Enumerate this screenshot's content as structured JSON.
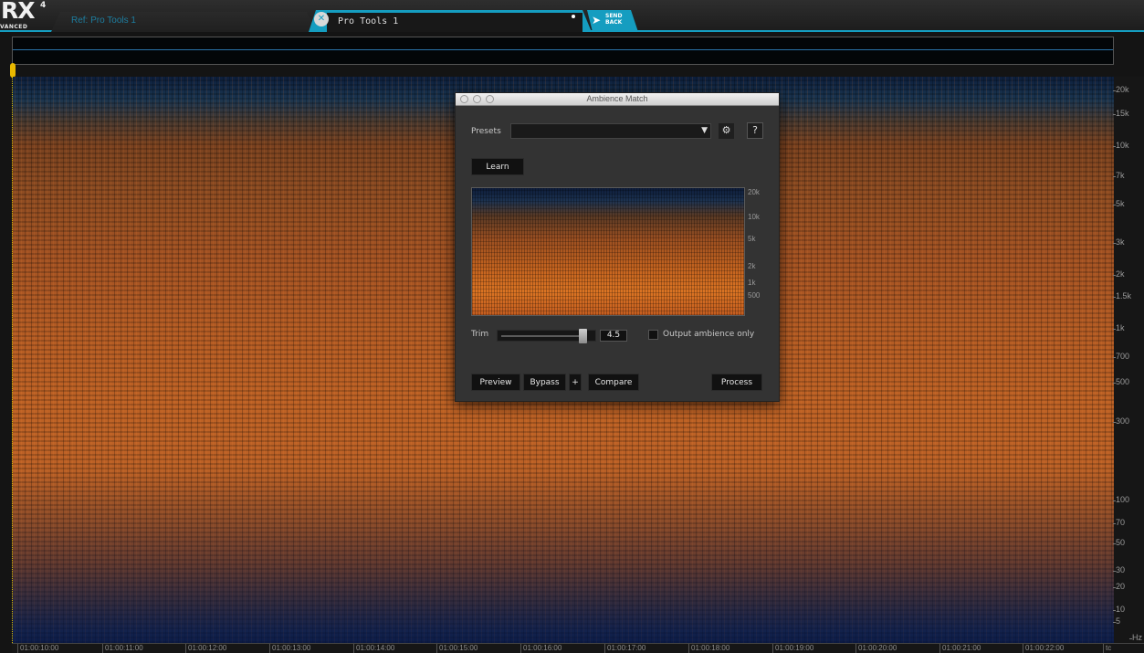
{
  "app": {
    "logo": "RX",
    "logo_version": "4",
    "logo_subtitle": "VANCED"
  },
  "tabs": {
    "ref_tab": "Ref: Pro Tools 1",
    "active_tab": "Pro Tools 1",
    "send_back_label": "SEND BACK"
  },
  "frequency_axis": {
    "labels": [
      "20k",
      "15k",
      "10k",
      "7k",
      "5k",
      "3k",
      "2k",
      "1.5k",
      "1k",
      "700",
      "500",
      "300",
      "100",
      "70",
      "50",
      "30",
      "20",
      "10",
      "5"
    ],
    "unit": "Hz"
  },
  "time_axis": {
    "labels": [
      "01:00:10:00",
      "01:00:11:00",
      "01:00:12:00",
      "01:00:13:00",
      "01:00:14:00",
      "01:00:15:00",
      "01:00:16:00",
      "01:00:17:00",
      "01:00:18:00",
      "01:00:19:00",
      "01:00:20:00",
      "01:00:21:00",
      "01:00:22:00"
    ],
    "unit": "tc"
  },
  "dialog": {
    "title": "Ambience Match",
    "presets_label": "Presets",
    "presets_value": "",
    "presets_arrow": "▼",
    "gear_icon": "⚙",
    "help_label": "?",
    "learn_label": "Learn",
    "mini_spectrum_labels": [
      "20k",
      "10k",
      "5k",
      "2k",
      "1k",
      "500"
    ],
    "trim_label": "Trim",
    "trim_value": "4.5",
    "trim_level": 0.91,
    "output_ambience_label": "Output ambience only",
    "output_ambience_checked": false,
    "preview_label": "Preview",
    "bypass_label": "Bypass",
    "plus_label": "+",
    "compare_label": "Compare",
    "process_label": "Process"
  },
  "colors": {
    "accent": "#159dc0",
    "playhead": "#e8b800"
  }
}
